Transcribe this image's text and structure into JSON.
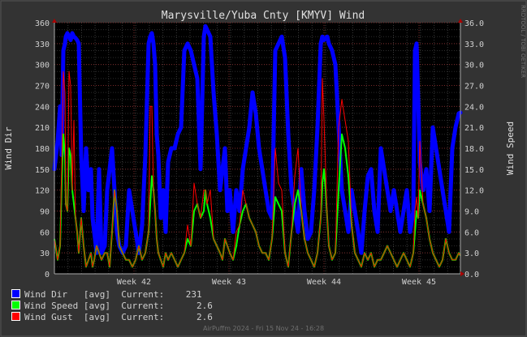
{
  "chart_data": {
    "type": "line",
    "title": "Marysville/Yuba Cnty [KMYV] Wind",
    "ylabel_left": "Wind Dir",
    "ylabel_right": "Wind Speed",
    "watermark": "RRDTOOL / TOBI OETIKER",
    "ylim_left": [
      0,
      360
    ],
    "ylim_right": [
      0,
      36
    ],
    "yticks_left": [
      "0",
      "30",
      "60",
      "90",
      "120",
      "150",
      "180",
      "210",
      "240",
      "270",
      "300",
      "330",
      "360"
    ],
    "yticks_right": [
      "0.0",
      "3.0",
      "6.0",
      "9.0",
      "12.0",
      "15.0",
      "18.0",
      "21.0",
      "24.0",
      "27.0",
      "30.0",
      "33.0",
      "36.0"
    ],
    "xlim": [
      0,
      500
    ],
    "week_ticks": [
      {
        "label": "Week 42",
        "x": 98
      },
      {
        "label": "Week 43",
        "x": 215
      },
      {
        "label": "Week 44",
        "x": 332
      },
      {
        "label": "Week 45",
        "x": 449
      }
    ],
    "series": [
      {
        "name": "Wind Dir",
        "axis": "left",
        "color": "#0000ff",
        "x": [
          0,
          4,
          7,
          9,
          11,
          13,
          14,
          16,
          18,
          20,
          22,
          24,
          26,
          28,
          30,
          33,
          36,
          39,
          42,
          45,
          47,
          49,
          52,
          55,
          58,
          62,
          65,
          68,
          71,
          74,
          77,
          80,
          84,
          88,
          92,
          96,
          100,
          104,
          108,
          112,
          116,
          118,
          120,
          122,
          124,
          126,
          128,
          131,
          134,
          137,
          140,
          144,
          148,
          152,
          156,
          160,
          164,
          168,
          172,
          176,
          180,
          184,
          186,
          188,
          192,
          196,
          200,
          204,
          207,
          210,
          213,
          216,
          220,
          224,
          228,
          232,
          236,
          240,
          244,
          248,
          252,
          256,
          260,
          264,
          268,
          272,
          276,
          280,
          284,
          288,
          292,
          296,
          300,
          304,
          308,
          312,
          316,
          320,
          324,
          328,
          330,
          332,
          334,
          336,
          338,
          342,
          346,
          350,
          354,
          358,
          362,
          366,
          370,
          374,
          378,
          382,
          386,
          390,
          394,
          398,
          402,
          406,
          410,
          414,
          418,
          422,
          426,
          430,
          434,
          438,
          442,
          444,
          446,
          448,
          450,
          454,
          458,
          462,
          466,
          470,
          474,
          478,
          482,
          486,
          490,
          494,
          498,
          500
        ],
        "values": [
          150,
          190,
          240,
          170,
          320,
          330,
          340,
          345,
          340,
          335,
          345,
          340,
          338,
          335,
          330,
          170,
          90,
          180,
          120,
          150,
          80,
          60,
          30,
          150,
          30,
          40,
          120,
          150,
          180,
          120,
          60,
          40,
          30,
          40,
          120,
          90,
          60,
          30,
          70,
          170,
          330,
          340,
          345,
          330,
          300,
          200,
          170,
          80,
          120,
          60,
          160,
          180,
          180,
          200,
          210,
          320,
          330,
          320,
          300,
          280,
          150,
          340,
          355,
          350,
          340,
          260,
          200,
          120,
          150,
          180,
          90,
          120,
          60,
          120,
          90,
          150,
          180,
          210,
          260,
          230,
          180,
          150,
          120,
          90,
          80,
          320,
          330,
          340,
          310,
          200,
          120,
          90,
          60,
          150,
          90,
          50,
          60,
          120,
          210,
          330,
          340,
          335,
          338,
          340,
          330,
          320,
          300,
          210,
          120,
          90,
          60,
          120,
          90,
          60,
          30,
          90,
          140,
          150,
          90,
          60,
          180,
          150,
          120,
          90,
          120,
          90,
          60,
          90,
          120,
          60,
          90,
          320,
          330,
          250,
          160,
          120,
          150,
          90,
          210,
          180,
          150,
          120,
          90,
          60,
          180,
          210,
          230,
          231
        ]
      },
      {
        "name": "Wind Speed",
        "axis": "right",
        "color": "#00ff00",
        "x": [
          0,
          4,
          7,
          9,
          11,
          13,
          14,
          16,
          18,
          20,
          22,
          24,
          26,
          28,
          30,
          33,
          36,
          39,
          42,
          45,
          47,
          49,
          52,
          55,
          58,
          62,
          65,
          68,
          71,
          74,
          77,
          80,
          84,
          88,
          92,
          96,
          100,
          104,
          108,
          112,
          116,
          118,
          120,
          122,
          124,
          126,
          128,
          131,
          134,
          137,
          140,
          144,
          148,
          152,
          156,
          160,
          164,
          168,
          172,
          176,
          180,
          184,
          186,
          188,
          192,
          196,
          200,
          204,
          207,
          210,
          213,
          216,
          220,
          224,
          228,
          232,
          236,
          240,
          244,
          248,
          252,
          256,
          260,
          264,
          268,
          272,
          276,
          280,
          284,
          288,
          292,
          296,
          300,
          304,
          308,
          312,
          316,
          320,
          324,
          328,
          330,
          332,
          334,
          336,
          338,
          342,
          346,
          350,
          354,
          358,
          362,
          366,
          370,
          374,
          378,
          382,
          386,
          390,
          394,
          398,
          402,
          406,
          410,
          414,
          418,
          422,
          426,
          430,
          434,
          438,
          442,
          444,
          446,
          448,
          450,
          454,
          458,
          462,
          466,
          470,
          474,
          478,
          482,
          486,
          490,
          494,
          498,
          500
        ],
        "values": [
          5,
          2,
          4,
          13,
          20,
          17,
          10,
          9,
          18,
          17,
          12,
          10,
          8,
          6,
          3,
          8,
          4,
          1,
          2,
          3,
          1,
          2,
          4,
          3,
          2,
          3,
          3,
          1,
          6,
          12,
          9,
          4,
          3,
          2,
          2,
          1,
          2,
          4,
          2,
          3,
          6,
          10,
          14,
          12,
          9,
          5,
          3,
          2,
          1,
          3,
          2,
          3,
          2,
          1,
          2,
          3,
          5,
          4,
          9,
          10,
          8,
          9,
          12,
          10,
          8,
          5,
          4,
          3,
          2,
          5,
          4,
          3,
          2,
          4,
          7,
          9,
          10,
          8,
          7,
          6,
          4,
          3,
          3,
          2,
          5,
          11,
          10,
          9,
          3,
          1,
          6,
          10,
          12,
          9,
          5,
          3,
          2,
          1,
          3,
          8,
          13,
          15,
          12,
          8,
          4,
          2,
          3,
          12,
          20,
          18,
          14,
          7,
          3,
          2,
          1,
          3,
          2,
          3,
          1,
          2,
          2,
          3,
          4,
          3,
          2,
          1,
          2,
          3,
          2,
          1,
          3,
          6,
          9,
          8,
          12,
          10,
          8,
          5,
          3,
          2,
          1,
          2,
          5,
          3,
          2,
          2,
          3,
          2.6
        ]
      },
      {
        "name": "Wind Gust",
        "axis": "right",
        "color": "#ff0000",
        "x": [
          0,
          4,
          7,
          9,
          11,
          13,
          14,
          16,
          18,
          20,
          22,
          24,
          26,
          28,
          30,
          33,
          36,
          39,
          42,
          45,
          47,
          49,
          52,
          55,
          58,
          62,
          65,
          68,
          71,
          74,
          77,
          80,
          84,
          88,
          92,
          96,
          100,
          104,
          108,
          112,
          116,
          118,
          120,
          122,
          124,
          126,
          128,
          131,
          134,
          137,
          140,
          144,
          148,
          152,
          156,
          160,
          164,
          168,
          172,
          176,
          180,
          184,
          186,
          188,
          192,
          196,
          200,
          204,
          207,
          210,
          213,
          216,
          220,
          224,
          228,
          232,
          236,
          240,
          244,
          248,
          252,
          256,
          260,
          264,
          268,
          272,
          276,
          280,
          284,
          288,
          292,
          296,
          300,
          304,
          308,
          312,
          316,
          320,
          324,
          328,
          330,
          332,
          334,
          336,
          338,
          342,
          346,
          350,
          354,
          358,
          362,
          366,
          370,
          374,
          378,
          382,
          386,
          390,
          394,
          398,
          402,
          406,
          410,
          414,
          418,
          422,
          426,
          430,
          434,
          438,
          442,
          444,
          446,
          448,
          450,
          454,
          458,
          462,
          466,
          470,
          474,
          478,
          482,
          486,
          490,
          494,
          498,
          500
        ],
        "values": [
          5,
          2,
          4,
          16,
          29,
          26,
          10,
          9,
          29,
          27,
          12,
          22,
          8,
          6,
          3,
          8,
          4,
          1,
          2,
          3,
          1,
          2,
          4,
          3,
          2,
          3,
          3,
          1,
          6,
          12,
          9,
          4,
          3,
          2,
          2,
          1,
          2,
          4,
          2,
          3,
          6,
          24,
          24,
          12,
          9,
          5,
          3,
          2,
          1,
          3,
          2,
          3,
          2,
          1,
          2,
          3,
          7,
          4,
          13,
          10,
          8,
          12,
          12,
          10,
          12,
          5,
          4,
          3,
          2,
          5,
          4,
          3,
          2,
          6,
          7,
          12,
          10,
          8,
          7,
          6,
          4,
          3,
          3,
          2,
          5,
          18,
          13,
          12,
          3,
          1,
          6,
          14,
          18,
          9,
          5,
          3,
          2,
          1,
          3,
          8,
          28,
          22,
          15,
          8,
          4,
          2,
          3,
          21,
          25,
          22,
          19,
          7,
          3,
          2,
          1,
          3,
          2,
          3,
          1,
          2,
          2,
          3,
          4,
          3,
          2,
          1,
          2,
          3,
          2,
          1,
          3,
          9,
          11,
          8,
          19,
          10,
          8,
          5,
          3,
          2,
          1,
          2,
          5,
          3,
          2,
          2,
          3,
          2.6
        ]
      }
    ]
  },
  "legend": [
    {
      "label": "Wind Dir   [avg]",
      "current_label": "Current:",
      "current": "231",
      "color": "#0000ff"
    },
    {
      "label": "Wind Speed [avg]",
      "current_label": "Current:",
      "current": "2.6",
      "color": "#00ff00"
    },
    {
      "label": "Wind Gust  [avg]",
      "current_label": "Current:",
      "current": "2.6",
      "color": "#ff0000"
    }
  ],
  "footer": "AirPuffm 2024 - Fri 15 Nov 24 - 16:28"
}
